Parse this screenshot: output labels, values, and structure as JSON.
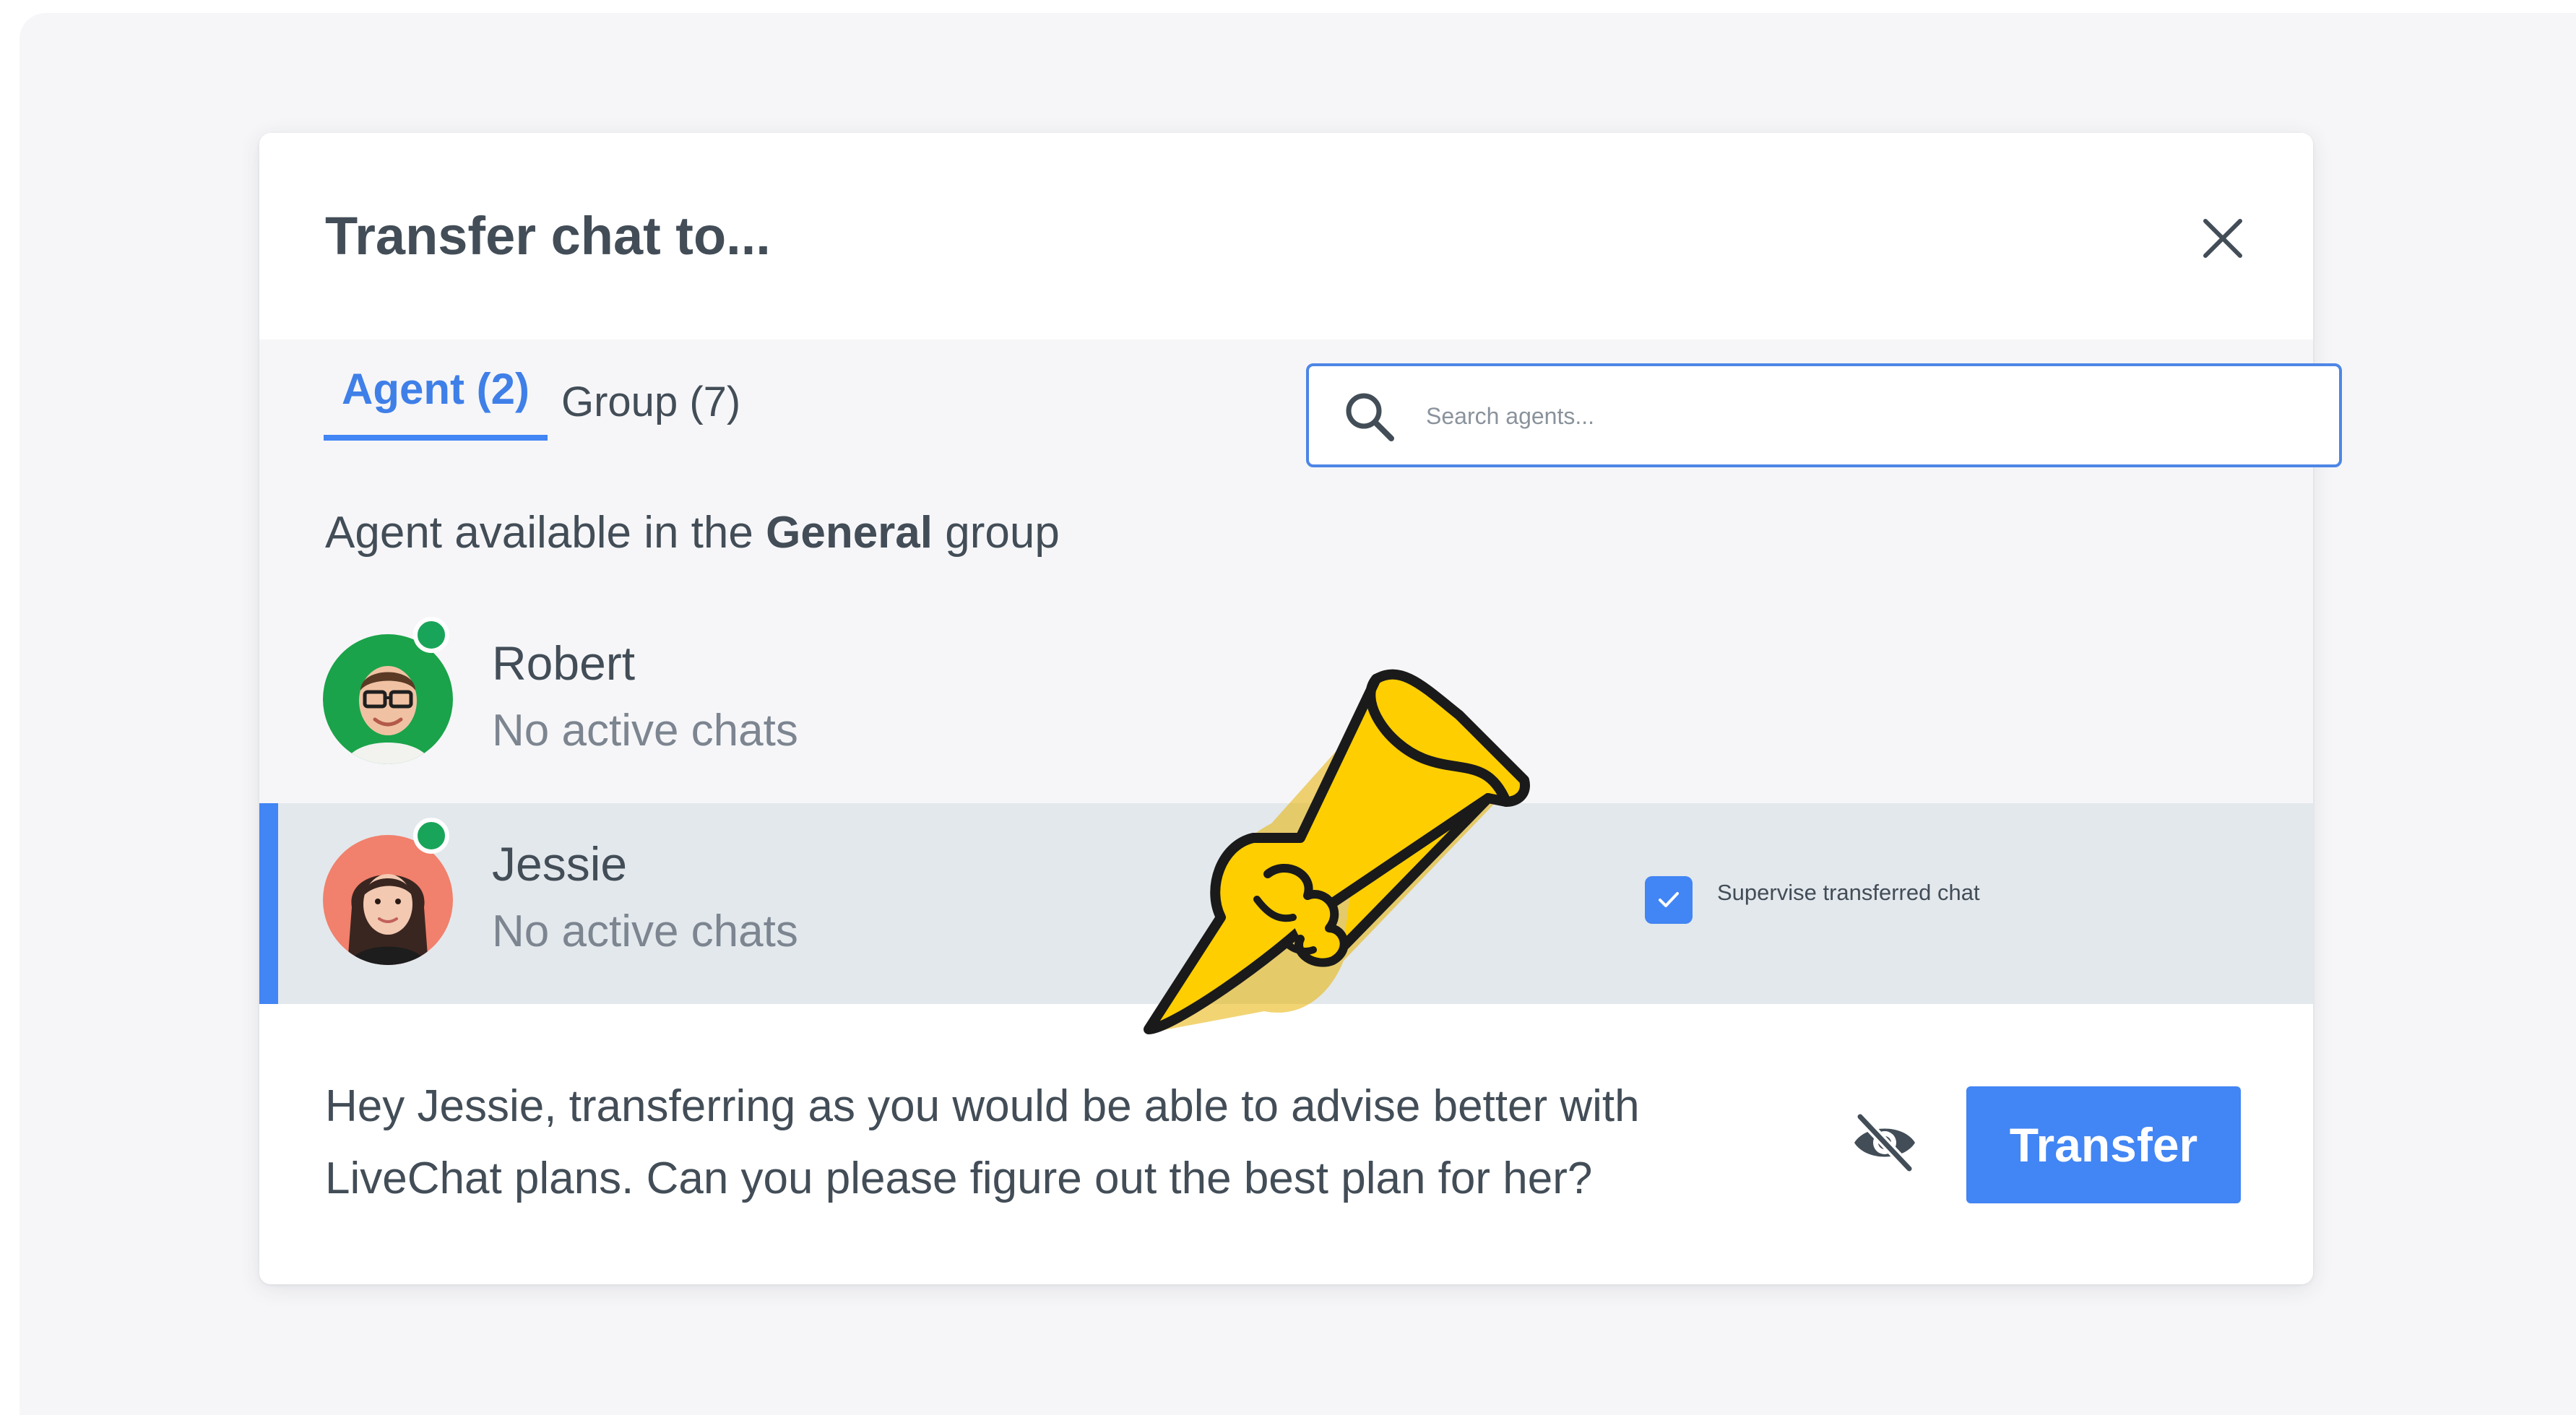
{
  "dialog": {
    "title": "Transfer chat to...",
    "close_icon": "close-icon"
  },
  "tabs": [
    {
      "label": "Agent (2)",
      "active": true
    },
    {
      "label": "Group (7)",
      "active": false
    }
  ],
  "search": {
    "placeholder": "Search agents...",
    "icon": "search-icon"
  },
  "subtitle": {
    "prefix": "Agent available in the ",
    "group": "General",
    "suffix": " group"
  },
  "agents": [
    {
      "name": "Robert",
      "status": "No active chats",
      "online": true,
      "selected": false,
      "avatar_bg": "#1aa34a"
    },
    {
      "name": "Jessie",
      "status": "No active chats",
      "online": true,
      "selected": true,
      "avatar_bg": "#f1806c"
    }
  ],
  "supervise": {
    "label": "Supervise transferred chat",
    "checked": true
  },
  "message": {
    "text": "Hey Jessie, transferring as you would be able to advise better with LiveChat plans. Can you please figure out the best plan for her?"
  },
  "actions": {
    "transfer_label": "Transfer",
    "hide_icon": "eye-slash-icon"
  },
  "colors": {
    "accent": "#4285f4",
    "online": "#18a55a",
    "selected_row": "#e3e8ec",
    "text": "#424d57",
    "muted": "#7c8590"
  }
}
